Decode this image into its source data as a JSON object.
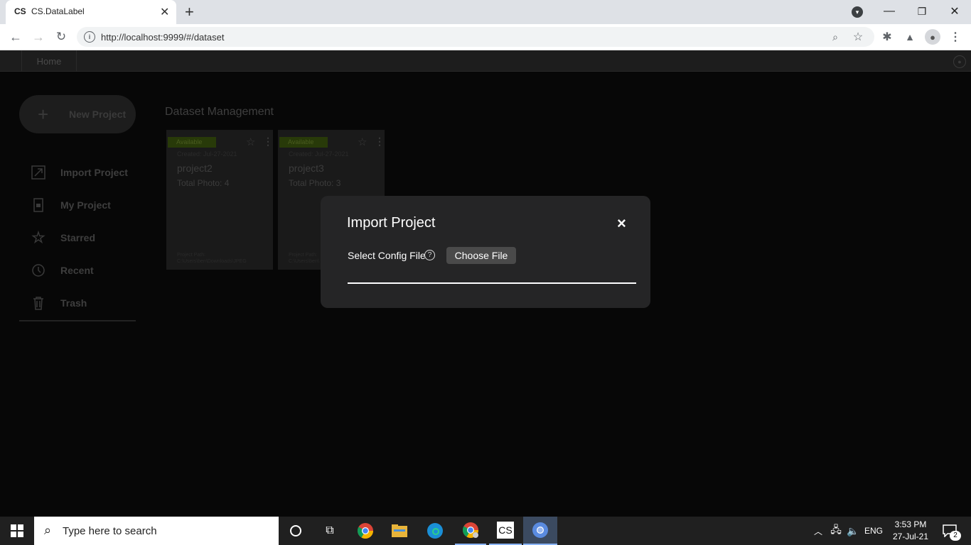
{
  "browser": {
    "tab_favicon": "CS",
    "tab_title": "CS.DataLabel",
    "new_tab": "+",
    "url": "http://localhost:9999/#/dataset"
  },
  "app": {
    "nav_home": "Home",
    "new_project": "New Project",
    "page_title": "Dataset Management",
    "sidebar": [
      {
        "label": "Import Project",
        "icon": "import-icon"
      },
      {
        "label": "My Project",
        "icon": "folder-icon"
      },
      {
        "label": "Starred",
        "icon": "star-icon"
      },
      {
        "label": "Recent",
        "icon": "history-icon"
      },
      {
        "label": "Trash",
        "icon": "trash-icon"
      }
    ],
    "cards": [
      {
        "status": "Available",
        "created": "Created: Jul-27-2021",
        "name": "project2",
        "photos": "Total Photo: 4",
        "path_label": "Project Path:",
        "path": "C:\\Users\\ben\\Downloads\\JPEG"
      },
      {
        "status": "Available",
        "created": "Created: Jul-27-2021",
        "name": "project3",
        "photos": "Total Photo: 3",
        "path_label": "Project Path:",
        "path": "C:\\Users\\ben\\"
      }
    ]
  },
  "modal": {
    "title": "Import Project",
    "close": "×",
    "field_label": "Select Config File",
    "help": "?",
    "choose_file": "Choose File"
  },
  "taskbar": {
    "search_placeholder": "Type here to search",
    "tray_lang": "ENG",
    "time": "3:53 PM",
    "date": "27-Jul-21",
    "notif_count": "2",
    "cs_app": "CS"
  },
  "colors": {
    "accent_badge": "#283a09",
    "modal_bg": "#252526",
    "app_bg": "#070707"
  }
}
